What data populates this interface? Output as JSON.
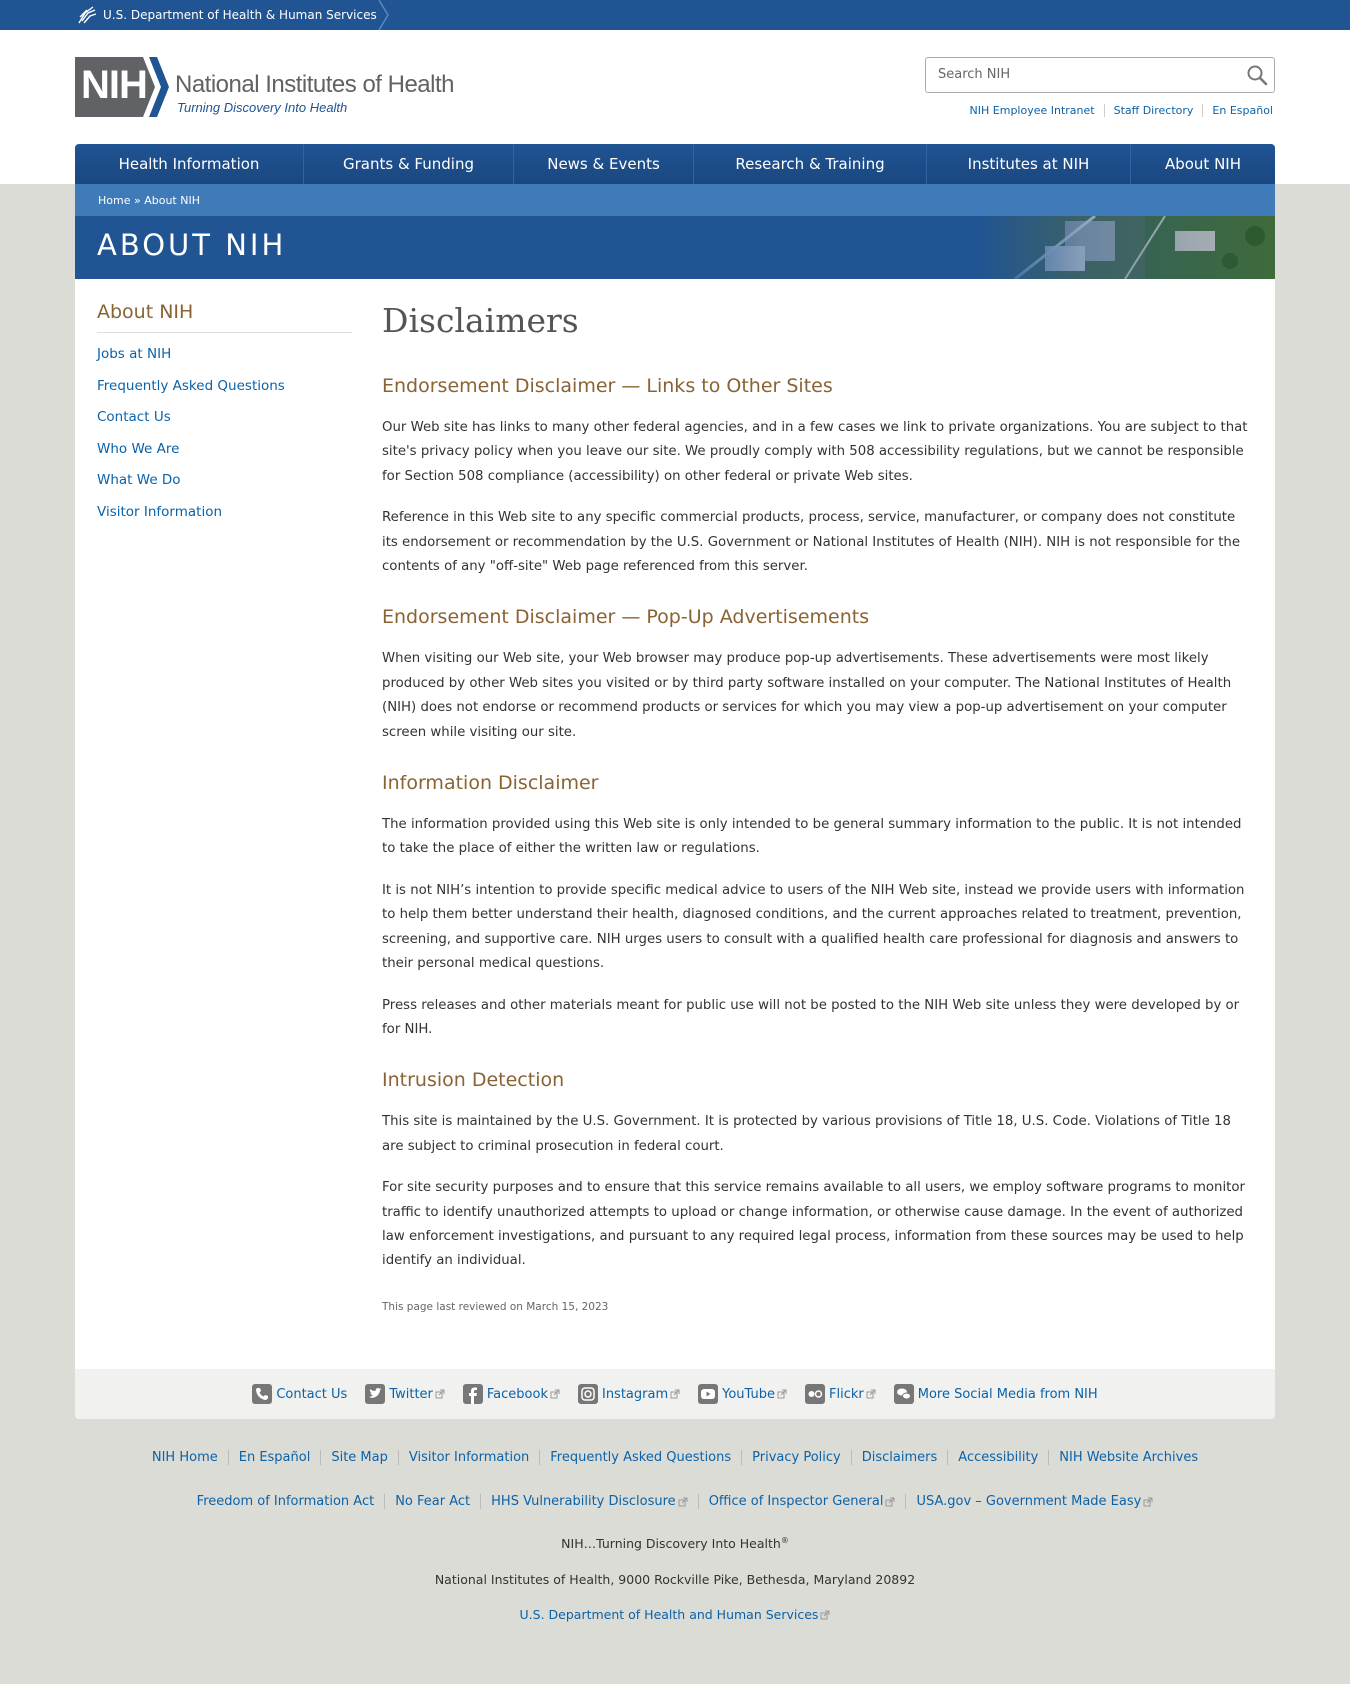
{
  "hhs_bar": {
    "label": "U.S. Department of Health & Human Services"
  },
  "logo": {
    "abbr": "NIH",
    "title": "National Institutes of Health",
    "tagline": "Turning Discovery Into Health"
  },
  "search": {
    "placeholder": "Search NIH",
    "value": ""
  },
  "utility_links": [
    "NIH Employee Intranet",
    "Staff Directory",
    "En Español"
  ],
  "nav": [
    {
      "label": "Health Information"
    },
    {
      "label": "Grants & Funding"
    },
    {
      "label": "News & Events"
    },
    {
      "label": "Research & Training"
    },
    {
      "label": "Institutes at NIH"
    },
    {
      "label": "About NIH"
    }
  ],
  "breadcrumb": {
    "home": "Home",
    "separator": " » ",
    "current": "About NIH"
  },
  "hero": {
    "title": "ABOUT NIH"
  },
  "sidebar": {
    "title": "About NIH",
    "items": [
      "Jobs at NIH",
      "Frequently Asked Questions",
      "Contact Us",
      "Who We Are",
      "What We Do",
      "Visitor Information"
    ]
  },
  "main": {
    "title": "Disclaimers",
    "sections": [
      {
        "heading": "Endorsement Disclaimer — Links to Other Sites",
        "paragraphs": [
          "Our Web site has links to many other federal agencies, and in a few cases we link to private organizations. You are subject to that site's privacy policy when you leave our site. We proudly comply with 508 accessibility regulations, but we cannot be responsible for Section 508 compliance (accessibility) on other federal or private Web sites.",
          "Reference in this Web site to any specific commercial products, process, service, manufacturer, or company does not constitute its endorsement or recommendation by the U.S. Government or National Institutes of Health (NIH). NIH is not responsible for the contents of any \"off-site\" Web page referenced from this server."
        ]
      },
      {
        "heading": "Endorsement Disclaimer — Pop-Up Advertisements",
        "paragraphs": [
          "When visiting our Web site, your Web browser may produce pop-up advertisements. These advertisements were most likely produced by other Web sites you visited or by third party software installed on your computer. The National Institutes of Health (NIH) does not endorse or recommend products or services for which you may view a pop-up advertisement on your computer screen while visiting our site."
        ]
      },
      {
        "heading": "Information Disclaimer",
        "paragraphs": [
          "The information provided using this Web site is only intended to be general summary information to the public. It is not intended to take the place of either the written law or regulations.",
          "It is not NIH’s intention to provide specific medical advice to users of the NIH Web site, instead we provide users with information to help them better understand their health, diagnosed conditions, and the current approaches related to treatment, prevention, screening, and supportive care. NIH urges users to consult with a qualified health care professional for diagnosis and answers to their personal medical questions.",
          "Press releases and other materials meant for public use will not be posted to the NIH Web site unless they were developed by or for NIH."
        ]
      },
      {
        "heading": "Intrusion Detection",
        "paragraphs": [
          "This site is maintained by the U.S. Government. It is protected by various provisions of Title 18, U.S. Code. Violations of Title 18 are subject to criminal prosecution in federal court.",
          "For site security purposes and to ensure that this service remains available to all users, we employ software programs to monitor traffic to identify unauthorized attempts to upload or change information, or otherwise cause damage. In the event of authorized law enforcement investigations, and pursuant to any required legal process, information from these sources may be used to help identify an individual."
        ]
      }
    ],
    "last_reviewed": "This page last reviewed on March 15, 2023"
  },
  "social": [
    {
      "label": "Contact Us",
      "icon": "phone-icon",
      "external": false
    },
    {
      "label": "Twitter",
      "icon": "twitter-icon",
      "external": true
    },
    {
      "label": "Facebook",
      "icon": "facebook-icon",
      "external": true
    },
    {
      "label": "Instagram",
      "icon": "instagram-icon",
      "external": true
    },
    {
      "label": "YouTube",
      "icon": "youtube-icon",
      "external": true
    },
    {
      "label": "Flickr",
      "icon": "flickr-icon",
      "external": true
    },
    {
      "label": "More Social Media from NIH",
      "icon": "chat-bubbles-icon",
      "external": false
    }
  ],
  "footer": {
    "row1": [
      "NIH Home",
      "En Español",
      "Site Map",
      "Visitor Information",
      "Frequently Asked Questions",
      "Privacy Policy",
      "Disclaimers",
      "Accessibility",
      "NIH Website Archives"
    ],
    "row2": [
      {
        "label": "Freedom of Information Act",
        "external": false
      },
      {
        "label": "No Fear Act",
        "external": false
      },
      {
        "label": "HHS Vulnerability Disclosure",
        "external": true
      },
      {
        "label": "Office of Inspector General",
        "external": true
      },
      {
        "label": "USA.gov – Government Made Easy",
        "external": true
      }
    ],
    "tagline": "NIH…Turning Discovery Into Health",
    "tagline_mark": "®",
    "address": "National Institutes of Health, 9000 Rockville Pike, Bethesda, Maryland 20892",
    "hhs_link": "U.S. Department of Health and Human Services"
  },
  "colors": {
    "brand_blue": "#205493",
    "link": "#0b62a8",
    "heading_brown": "#8a6335",
    "page_bg": "#dcdcd7"
  }
}
